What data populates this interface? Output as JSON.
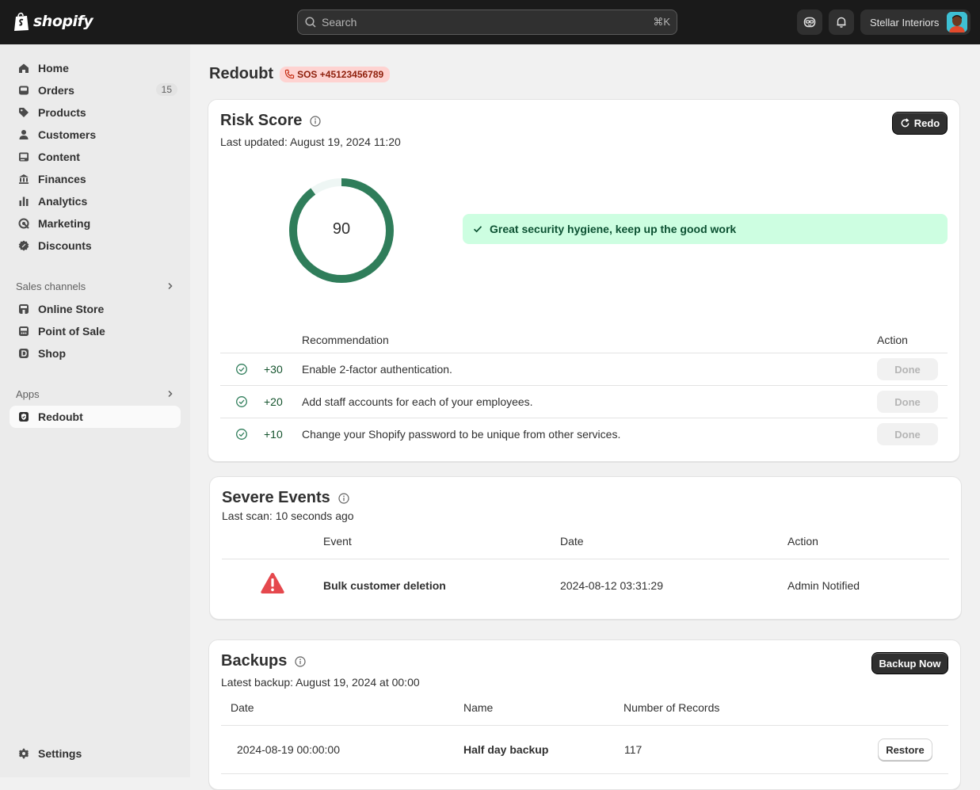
{
  "topbar": {
    "logo_text": "shopify",
    "search_placeholder": "Search",
    "search_shortcut": "⌘K",
    "store_name": "Stellar Interiors"
  },
  "sidebar": {
    "items": [
      {
        "label": "Home",
        "icon": "home-icon"
      },
      {
        "label": "Orders",
        "icon": "inbox-icon",
        "count": "15"
      },
      {
        "label": "Products",
        "icon": "tag-icon"
      },
      {
        "label": "Customers",
        "icon": "person-icon"
      },
      {
        "label": "Content",
        "icon": "image-icon"
      },
      {
        "label": "Finances",
        "icon": "bank-icon"
      },
      {
        "label": "Analytics",
        "icon": "bar-chart-icon"
      },
      {
        "label": "Marketing",
        "icon": "target-icon"
      },
      {
        "label": "Discounts",
        "icon": "discount-icon"
      }
    ],
    "sales_channels_title": "Sales channels",
    "channels": [
      {
        "label": "Online Store",
        "icon": "store-icon"
      },
      {
        "label": "Point of Sale",
        "icon": "pos-icon"
      },
      {
        "label": "Shop",
        "icon": "shop-icon"
      }
    ],
    "apps_title": "Apps",
    "apps": [
      {
        "label": "Redoubt",
        "icon": "shield-icon"
      }
    ],
    "settings_label": "Settings"
  },
  "page": {
    "title": "Redoubt",
    "sos_label": "SOS +45123456789"
  },
  "risk": {
    "title": "Risk Score",
    "last_updated": "Last updated: August 19, 2024 11:20",
    "redo_label": "Redo",
    "score": "90",
    "score_fraction": 0.9,
    "banner": "Great security hygiene, keep up the good work",
    "col_recommendation": "Recommendation",
    "col_action": "Action",
    "rows": [
      {
        "points": "+30",
        "text": "Enable 2-factor authentication.",
        "action": "Done"
      },
      {
        "points": "+20",
        "text": "Add staff accounts for each of your employees.",
        "action": "Done"
      },
      {
        "points": "+10",
        "text": "Change your Shopify password to be unique from other services.",
        "action": "Done"
      }
    ]
  },
  "events": {
    "title": "Severe Events",
    "last_scan": "Last scan: 10 seconds ago",
    "col_event": "Event",
    "col_date": "Date",
    "col_action": "Action",
    "rows": [
      {
        "event": "Bulk customer deletion",
        "date": "2024-08-12 03:31:29",
        "action": "Admin Notified"
      }
    ]
  },
  "backups": {
    "title": "Backups",
    "latest": "Latest backup: August 19, 2024 at 00:00",
    "backup_now_label": "Backup Now",
    "col_date": "Date",
    "col_name": "Name",
    "col_records": "Number of Records",
    "rows": [
      {
        "date": "2024-08-19 00:00:00",
        "name": "Half day backup",
        "records": "117",
        "action": "Restore"
      }
    ]
  },
  "colors": {
    "gauge": "#2f7d5a",
    "banner_bg": "#cdfee1",
    "alert_red": "#e5484d"
  }
}
